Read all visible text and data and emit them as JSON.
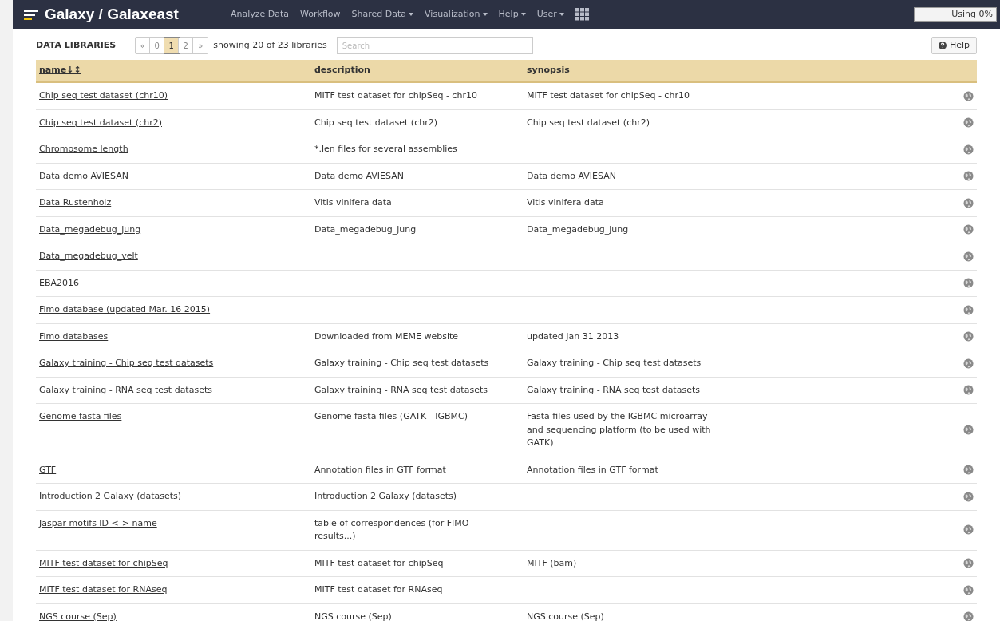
{
  "navbar": {
    "brand": "Galaxy / Galaxeast",
    "menu": [
      {
        "label": "Analyze Data",
        "dropdown": false
      },
      {
        "label": "Workflow",
        "dropdown": false
      },
      {
        "label": "Shared Data",
        "dropdown": true
      },
      {
        "label": "Visualization",
        "dropdown": true
      },
      {
        "label": "Help",
        "dropdown": true
      },
      {
        "label": "User",
        "dropdown": true
      }
    ],
    "usage": {
      "label": "Using 0%",
      "level": 0
    }
  },
  "toolbar": {
    "title": "DATA LIBRARIES",
    "pages": [
      {
        "label": "«",
        "selected": false
      },
      {
        "label": "0",
        "selected": false
      },
      {
        "label": "1",
        "selected": true
      },
      {
        "label": "2",
        "selected": false
      },
      {
        "label": "»",
        "selected": false
      }
    ],
    "showing_prefix": "showing",
    "showing_count": "20",
    "showing_suffix": "of 23 libraries",
    "search": {
      "placeholder": "Search"
    },
    "help_button": "Help"
  },
  "table": {
    "columns": [
      "name↓↕",
      "description",
      "synopsis"
    ],
    "rows": [
      {
        "name": "Chip seq test dataset (chr10)",
        "description": "MITF test dataset for chipSeq - chr10",
        "synopsis": "MITF test dataset for chipSeq - chr10"
      },
      {
        "name": "Chip seq test dataset (chr2)",
        "description": "Chip seq test dataset (chr2)",
        "synopsis": "Chip seq test dataset (chr2)"
      },
      {
        "name": "Chromosome length",
        "description": "*.len files for several assemblies",
        "synopsis": ""
      },
      {
        "name": "Data demo AVIESAN",
        "description": "Data demo AVIESAN",
        "synopsis": "Data demo AVIESAN"
      },
      {
        "name": "Data Rustenholz",
        "description": "Vitis vinifera data",
        "synopsis": "Vitis vinifera data"
      },
      {
        "name": "Data_megadebug_jung",
        "description": "Data_megadebug_jung",
        "synopsis": "Data_megadebug_jung"
      },
      {
        "name": "Data_megadebug_velt",
        "description": "",
        "synopsis": ""
      },
      {
        "name": "EBA2016",
        "description": "",
        "synopsis": ""
      },
      {
        "name": "Fimo database (updated Mar. 16 2015)",
        "description": "",
        "synopsis": ""
      },
      {
        "name": "Fimo databases",
        "description": "Downloaded from MEME website",
        "synopsis": "updated Jan 31 2013"
      },
      {
        "name": "Galaxy training - Chip seq test datasets",
        "description": "Galaxy training - Chip seq test datasets",
        "synopsis": "Galaxy training - Chip seq test datasets"
      },
      {
        "name": "Galaxy training - RNA seq test datasets",
        "description": "Galaxy training - RNA seq test datasets",
        "synopsis": "Galaxy training - RNA seq test datasets"
      },
      {
        "name": "Genome fasta files",
        "description": "Genome fasta files (GATK - IGBMC)",
        "synopsis": "Fasta files used by the IGBMC microarray and sequencing platform (to be used with GATK)"
      },
      {
        "name": "GTF",
        "description": "Annotation files in GTF format",
        "synopsis": "Annotation files in GTF format"
      },
      {
        "name": "Introduction 2 Galaxy (datasets)",
        "description": "Introduction 2 Galaxy (datasets)",
        "synopsis": ""
      },
      {
        "name": "Jaspar motifs ID <-> name",
        "description": "table of correspondences (for FIMO results...)",
        "synopsis": ""
      },
      {
        "name": "MITF test dataset for chipSeq",
        "description": "MITF test dataset for chipSeq",
        "synopsis": "MITF (bam)"
      },
      {
        "name": "MITF test dataset for RNAseq",
        "description": "MITF test dataset for RNAseq",
        "synopsis": ""
      },
      {
        "name": "NGS course (Sep)",
        "description": "NGS course (Sep)",
        "synopsis": "NGS course (Sep)"
      }
    ]
  }
}
